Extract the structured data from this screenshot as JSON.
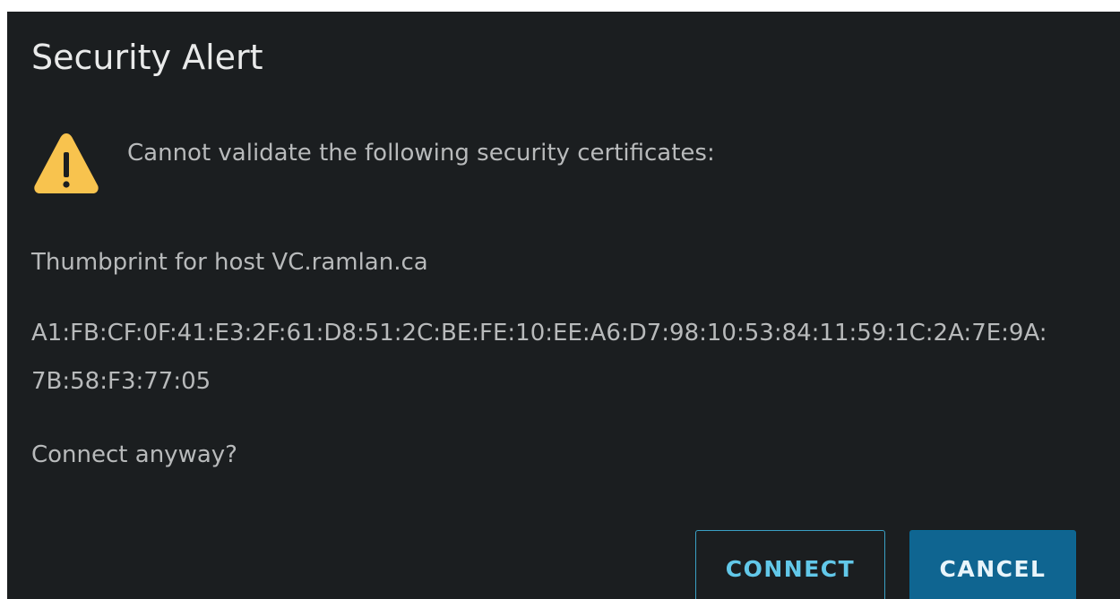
{
  "dialog": {
    "title": "Security Alert",
    "warning_message": "Cannot validate the following security certificates:",
    "host_line": "Thumbprint for host VC.ramlan.ca",
    "thumbprint": "A1:FB:CF:0F:41:E3:2F:61:D8:51:2C:BE:FE:10:EE:A6:D7:98:10:53:84:11:59:1C:2A:7E:9A:7B:58:F3:77:05",
    "question": "Connect anyway?",
    "buttons": {
      "connect_label": "CONNECT",
      "cancel_label": "CANCEL"
    },
    "icon": "warning-triangle-icon",
    "colors": {
      "background": "#1b1e20",
      "warning": "#f8c34e",
      "accent": "#62c8e9",
      "primary_button": "#0f6591"
    }
  }
}
